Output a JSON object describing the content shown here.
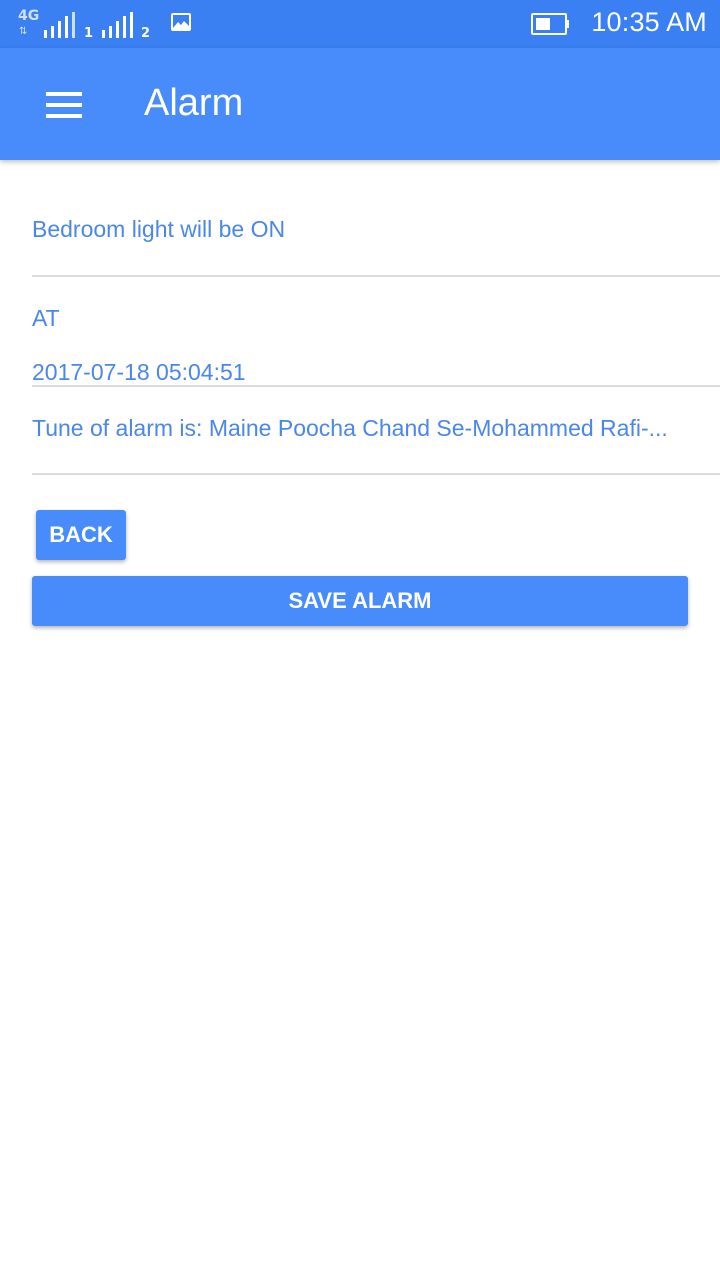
{
  "status_bar": {
    "network": "4G",
    "network_arrows": "⇅",
    "sim1": "1",
    "sim2": "2",
    "time": "10:35 AM",
    "battery_level": 0.55,
    "icons": [
      "signal-icon",
      "gallery-icon",
      "battery-icon"
    ]
  },
  "app_bar": {
    "title": "Alarm",
    "menu_icon": "hamburger-menu-icon"
  },
  "alarm": {
    "device_status": "Bedroom light will be ON",
    "at_label": "AT",
    "datetime": "2017-07-18 05:04:51",
    "tune": "Tune of alarm is: Maine Poocha Chand Se-Mohammed Rafi-..."
  },
  "buttons": {
    "back": "BACK",
    "save": "SAVE ALARM"
  },
  "colors": {
    "status_bar": "#3a80f2",
    "app_bar": "#488bfb",
    "accent_text": "#4a87e9",
    "divider": "#dcdcdc"
  }
}
